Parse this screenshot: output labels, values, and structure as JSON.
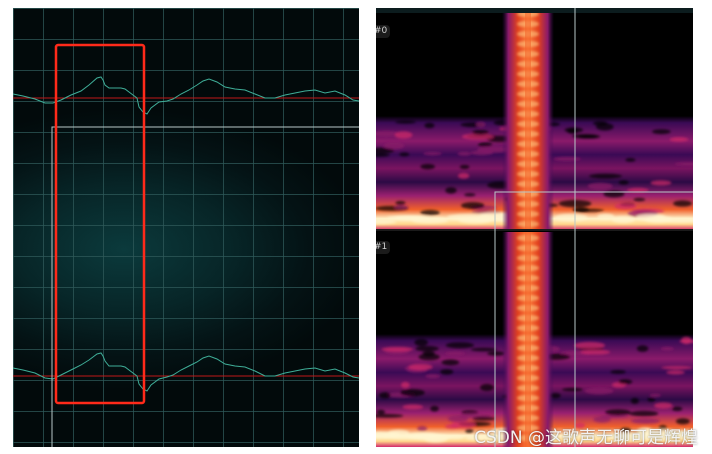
{
  "waveform_view": {
    "channels": 2,
    "colors": {
      "waveform": "#3fae98",
      "baseline": "#c01818",
      "grid": "#2f5a5a",
      "selection_outline": "#ff2a1a",
      "playhead": "#b8c8c8"
    }
  },
  "spectrogram_view": {
    "channel_labels": [
      "#0",
      "#1"
    ],
    "colormap": [
      "#000000",
      "#3a0a55",
      "#8a1a6a",
      "#d2286a",
      "#f0602a",
      "#ffd58a",
      "#fff6d0"
    ]
  },
  "watermark": {
    "text": "CSDN @这歌声无聊可是辉煌"
  }
}
